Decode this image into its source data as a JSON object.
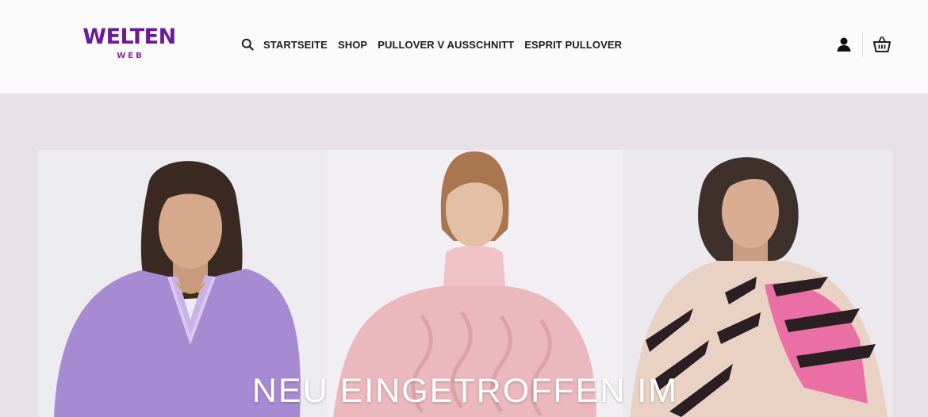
{
  "brand": {
    "name": "WELTEN",
    "sub": "WEB",
    "color_primary": "#6a1b9a",
    "color_secondary": "#8e24aa"
  },
  "nav": {
    "search_icon": "search-icon",
    "links": [
      {
        "label": "STARTSEITE"
      },
      {
        "label": "SHOP"
      },
      {
        "label": "PULLOVER V AUSSCHNITT"
      },
      {
        "label": "ESPRIT PULLOVER"
      }
    ]
  },
  "header_icons": {
    "account": "user-icon",
    "cart": "basket-icon"
  },
  "hero": {
    "title": "NEU EINGETROFFEN IM",
    "colors": {
      "background": "#e7e1e7",
      "sweater_left": "#a68bd3",
      "sweater_middle": "#ebb9bd",
      "sweater_right_pink": "#ea6fa4"
    }
  }
}
